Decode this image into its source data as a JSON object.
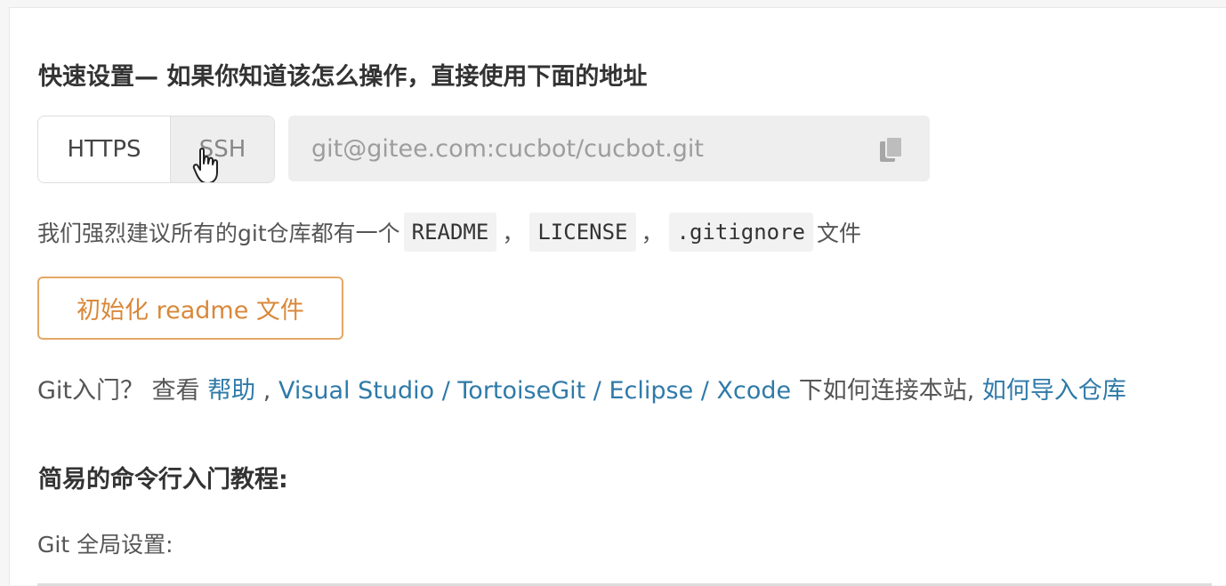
{
  "setup": {
    "title": "快速设置— 如果你知道该怎么操作，直接使用下面的地址",
    "protocols": [
      "HTTPS",
      "SSH"
    ],
    "selected_protocol": "SSH",
    "repo_url": "git@gitee.com:cucbot/cucbot.git",
    "copy_icon": "copy-icon"
  },
  "recommend": {
    "prefix": "我们强烈建议所有的git仓库都有一个",
    "files": [
      "README",
      "LICENSE",
      ".gitignore"
    ],
    "separator": "，",
    "suffix": "文件"
  },
  "init_button": {
    "label": "初始化 readme 文件"
  },
  "help": {
    "intro": "Git入门？ 查看 ",
    "help_link": "帮助",
    "sep1": " , ",
    "visual_studio": "Visual Studio",
    "slash1": " / ",
    "tortoisegit": "TortoiseGit",
    "slash2": " / ",
    "eclipse": "Eclipse",
    "slash3": " / ",
    "xcode": "Xcode",
    "connect_text": " 下如何连接本站, ",
    "import_link": "如何导入仓库"
  },
  "tutorial": {
    "title": "简易的命令行入门教程:",
    "global_settings": "Git 全局设置:"
  },
  "colors": {
    "accent_orange": "#e4a865",
    "link_blue": "#2f7aa8"
  }
}
